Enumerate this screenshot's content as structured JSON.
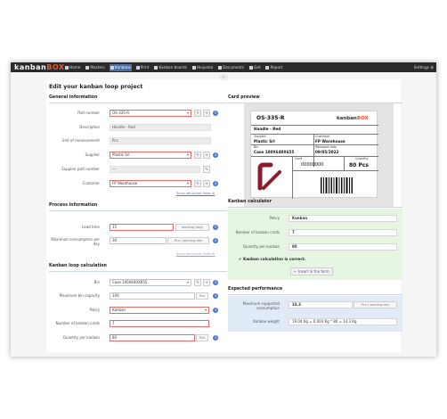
{
  "app": {
    "logo_main": "kanban",
    "logo_accent": "BOX",
    "settings": "Settings ⚙"
  },
  "nav": [
    {
      "label": "Home",
      "icon": "home-icon"
    },
    {
      "label": "Masters",
      "icon": "list-icon"
    },
    {
      "label": "Kanbans",
      "icon": "kanban-icon",
      "active": true
    },
    {
      "label": "Print",
      "icon": "printer-icon"
    },
    {
      "label": "Kanban boards",
      "icon": "board-icon"
    },
    {
      "label": "Heijunka",
      "icon": "heijunka-icon"
    },
    {
      "label": "Documents",
      "icon": "document-icon"
    },
    {
      "label": "Get",
      "icon": "download-icon"
    },
    {
      "label": "Report",
      "icon": "report-icon"
    }
  ],
  "collapse_glyph": "⌄",
  "page_title": "Edit your kanban loop project",
  "general": {
    "heading": "General information",
    "part_number_label": "Part number",
    "part_number_value": "OS-335-R",
    "description_label": "Description",
    "description_value": "Handle - Red",
    "unit_label": "Unit of measurement",
    "unit_value": "Pcs",
    "supplier_label": "Supplier",
    "supplier_value": "Plastic Srl",
    "supplier_part_label": "Supplier part number",
    "supplier_part_value": "---",
    "customer_label": "Customer",
    "customer_value": "FP Warehouse",
    "advanced": "Show advanced fields ⊕"
  },
  "process": {
    "heading": "Process information",
    "lead_label": "Lead time",
    "lead_value": "15",
    "lead_unit": "working days",
    "maxcons_label": "Maximum consumption per day",
    "maxcons_value": "30",
    "maxcons_unit": "Pcs / working day",
    "advanced": "Show advanced fields ⊕"
  },
  "loop": {
    "heading": "Kanban loop calculation",
    "bin_label": "Bin",
    "bin_value": "Case 100X640X655",
    "maxbin_label": "Maximum bin capacity",
    "maxbin_value": "100",
    "maxbin_unit": "Pcs",
    "policy_label": "Policy",
    "policy_value": "Kanban",
    "cards_label": "Number of kanban cards",
    "cards_value": "7",
    "qty_label": "Quantity per kanban",
    "qty_value": "80",
    "qty_unit": "Pcs"
  },
  "preview": {
    "heading": "Card preview",
    "part": "OS-335-R",
    "logo_main": "kanban",
    "logo_accent": "BOX",
    "desc": "Handle - Red",
    "supplier_lbl": "Supplier",
    "supplier_val": "Plastic Srl",
    "customer_lbl": "Customer",
    "customer_val": "FP Warehouse",
    "bin_lbl": "Bin",
    "bin_val": "Case 100X640X655",
    "released_lbl": "Released date",
    "released_val": "09/05/2022",
    "card_lbl": "Card",
    "card_val": "00000000",
    "qty_lbl": "Quantity",
    "qty_val": "80 Pcs"
  },
  "calculator": {
    "heading": "Kanban calculator",
    "policy_label": "Policy",
    "policy_value": "Kanban",
    "cards_label": "Number of kanban cards",
    "cards_value": "7",
    "qty_label": "Quantity per kanban",
    "qty_value": "80",
    "correct": "✔ Kanban calculation is correct.",
    "insert_button": "← Insert in the form"
  },
  "performance": {
    "heading": "Expected performance",
    "maxcons_label": "Maximum supported consumption",
    "maxcons_value": "33.3",
    "maxcons_unit": "Pcs / working day",
    "weight_label": "Kanban weight",
    "weight_value": "19.04 Kg = 0.003 Kg * 80 = 14.3 Kg"
  },
  "colors": {
    "accent": "#4a6fa5",
    "brand": "#e05a37",
    "required": "#e46a6a",
    "calc_bg": "#e6f6e3",
    "perf_bg": "#e1ebf8"
  }
}
